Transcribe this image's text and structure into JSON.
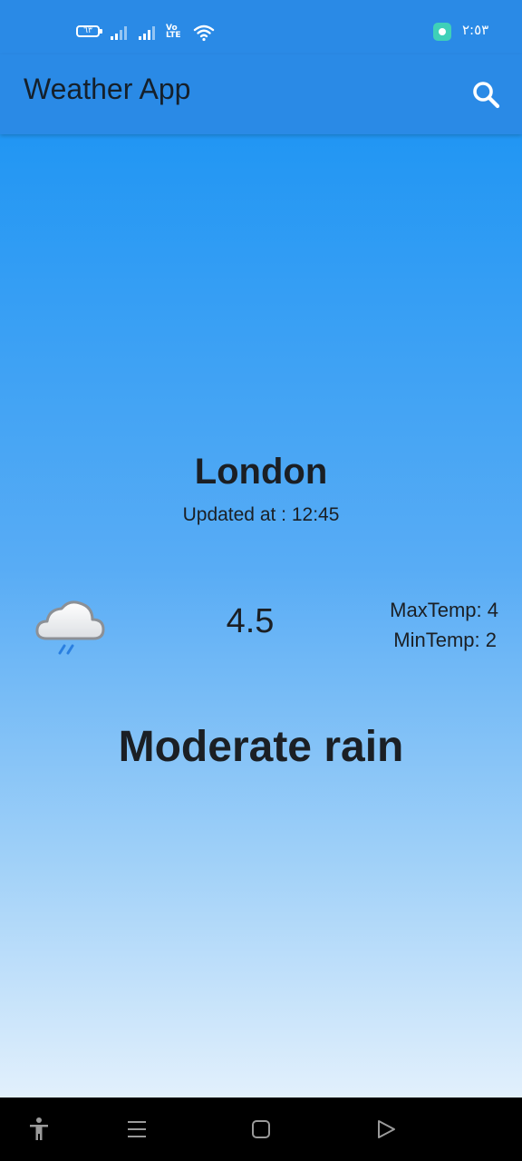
{
  "status_bar": {
    "battery_level": "٦٣",
    "network": "Vo LTE",
    "clock": "٢:٥٣",
    "icons": [
      "battery-icon",
      "signal-icon",
      "signal-icon",
      "volte-icon",
      "wifi-icon",
      "app-notification-icon"
    ]
  },
  "app_bar": {
    "title": "Weather App",
    "search_icon": "search-icon"
  },
  "weather": {
    "city": "London",
    "updated": "Updated at : 12:45",
    "icon": "rain-cloud-icon",
    "temperature": "4.5",
    "max_temp": "MaxTemp: 4",
    "min_temp": "MinTemp: 2",
    "condition": "Moderate rain"
  },
  "nav_bar": {
    "buttons": [
      "accessibility-icon",
      "recent-apps-icon",
      "home-icon",
      "back-icon"
    ]
  },
  "colors": {
    "app_bar": "#2a8ae6",
    "gradient_top": "#2196f3",
    "gradient_bottom": "#e2f0fc",
    "text": "#1b1f24"
  }
}
